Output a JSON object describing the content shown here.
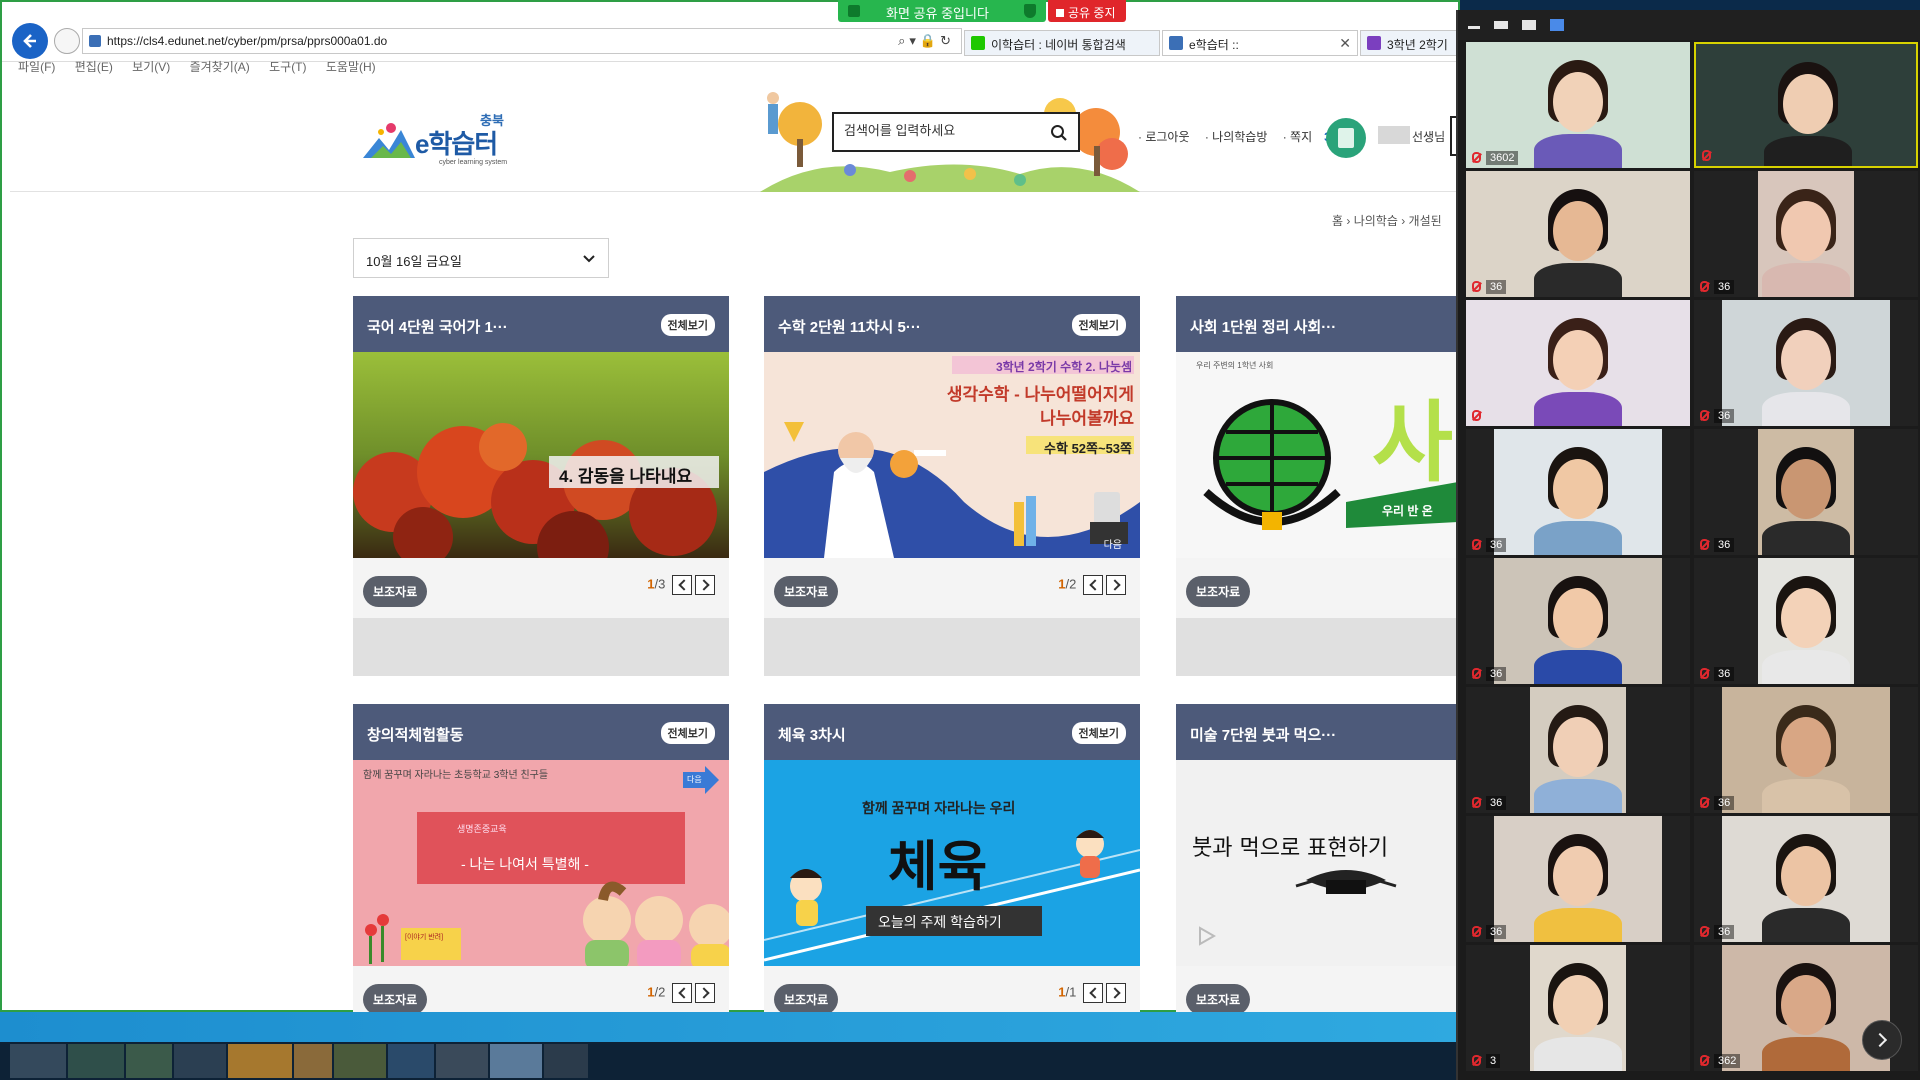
{
  "share_banner": {
    "status": "화면 공유 중입니다",
    "stop": "공유 중지"
  },
  "browser": {
    "url": "https://cls4.edunet.net/cyber/pm/prsa/pprs000a01.do",
    "tabs": [
      {
        "label": "이학습터 : 네이버 통합검색"
      },
      {
        "label": "e학습터 ::"
      },
      {
        "label": "3학년 2학기"
      }
    ],
    "menu": [
      "파일(F)",
      "편집(E)",
      "보기(V)",
      "즐겨찾기(A)",
      "도구(T)",
      "도움말(H)"
    ]
  },
  "site": {
    "logo_region": "충북",
    "logo_title": "e학습터",
    "logo_sub": "cyber learning system",
    "search_placeholder": "검색어를 입력하세요",
    "links": {
      "logout": "· 로그아웃",
      "my_room": "· 나의학습방",
      "note": "· 쪽지",
      "note_count": "3"
    },
    "user_name": "선생님",
    "breadcrumb": "홈  ›  나의학습  ›  개설된"
  },
  "date_select": {
    "value": "10월 16일 금요일"
  },
  "cards": [
    {
      "title": "국어 4단원 국어가 1···",
      "all": "전체보기",
      "img_text": "4. 감동을 나타내요",
      "aux": "보조자료",
      "page_cur": "1",
      "page_total": "/3"
    },
    {
      "title": "수학 2단원 11차시 5···",
      "all": "전체보기",
      "img_line1": "3학년 2학기 수학 2. 나눗셈",
      "img_line2": "생각수학 - 나누어떨어지게",
      "img_line3": "나누어볼까요",
      "img_line4": "수학 52쪽~53쪽",
      "img_badge": "다음",
      "aux": "보조자료",
      "page_cur": "1",
      "page_total": "/2"
    },
    {
      "title": "사회 1단원 정리 사회···",
      "img_small": "우리 주변의 1학년 사회",
      "img_big": "사",
      "img_ribbon": "우리 반 온",
      "aux": "보조자료"
    },
    {
      "title": "창의적체험활동",
      "all": "전체보기",
      "img_top": "함께 꿈꾸며 자라나는 초등학교 3학년 친구들",
      "img_box_small": "생명존중교육",
      "img_box_main": "- 나는 나여서 특별해 -",
      "img_next": "다음",
      "img_tag": "[이야기 반려]",
      "aux": "보조자료",
      "page_cur": "1",
      "page_total": "/2"
    },
    {
      "title": "체육 3차시",
      "all": "전체보기",
      "img_top": "함께 꿈꾸며 자라나는 우리",
      "img_big": "체육",
      "img_sub": "오늘의 주제 학습하기",
      "aux": "보조자료",
      "page_cur": "1",
      "page_total": "/1"
    },
    {
      "title": "미술 7단원 붓과 먹으···",
      "img_text": "붓과 먹으로 표현하기",
      "aux": "보조자료"
    }
  ],
  "participants": [
    {
      "label": "3602"
    },
    {
      "label": ""
    },
    {
      "label": "36"
    },
    {
      "label": "36"
    },
    {
      "label": ""
    },
    {
      "label": "36"
    },
    {
      "label": "36"
    },
    {
      "label": "36"
    },
    {
      "label": "36"
    },
    {
      "label": "36"
    },
    {
      "label": "36"
    },
    {
      "label": "36"
    },
    {
      "label": "36"
    },
    {
      "label": "36"
    },
    {
      "label": "3"
    },
    {
      "label": "362"
    }
  ],
  "colors": {
    "accent": "#1a63c6",
    "card_head": "#4d5a7a",
    "share_green": "#27b64e",
    "stop_red": "#e0262b"
  }
}
